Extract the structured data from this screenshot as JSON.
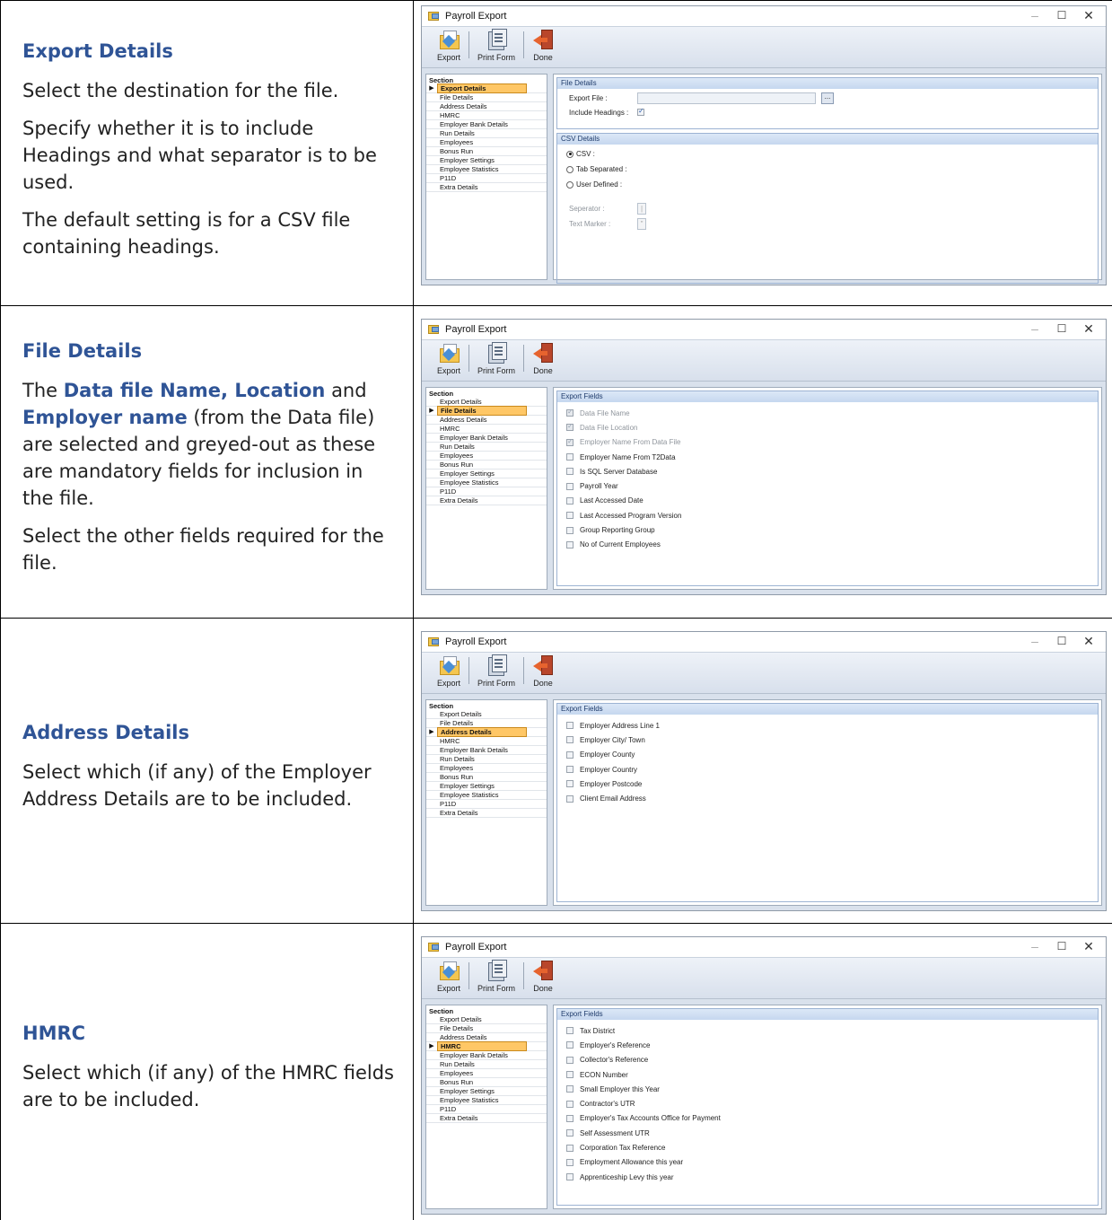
{
  "app": {
    "title": "Payroll Export",
    "toolbar": {
      "export_label": "Export",
      "print_label": "Print Form",
      "done_label": "Done"
    },
    "section_header": "Section",
    "sections": [
      "Export Details",
      "File Details",
      "Address Details",
      "HMRC",
      "Employer Bank Details",
      "Run Details",
      "Employees",
      "Bonus Run",
      "Employer Settings",
      "Employee Statistics",
      "P11D",
      "Extra Details"
    ],
    "export_fields_title": "Export Fields"
  },
  "rows": [
    {
      "heading": "Export Details",
      "p1": "Select the destination for the file.",
      "p2": "Specify whether it is to include Headings and what separator is to be used.",
      "p3": "The default setting is for a CSV file containing headings.",
      "file_details_title": "File Details",
      "export_file_label": "Export File :",
      "browse_label": "...",
      "include_headings_label": "Include Headings :",
      "csv_details_title": "CSV Details",
      "csv_label": "CSV :",
      "tab_label": "Tab Separated :",
      "user_label": "User Defined :",
      "separator_label": "Seperator :",
      "separator_value": "|",
      "text_marker_label": "Text Marker :",
      "text_marker_value": "\""
    },
    {
      "heading": "File Details",
      "intro": "The ",
      "hl1": "Data file Name, Location",
      "and": " and ",
      "hl2": "Employer name",
      "rest": " (from the Data file) are selected and greyed-out as these are mandatory fields for inclusion in the file.",
      "p2": "Select the other fields required for the file.",
      "fields": [
        {
          "label": "Data File Name",
          "checked": true,
          "disabled": true
        },
        {
          "label": "Data File Location",
          "checked": true,
          "disabled": true
        },
        {
          "label": "Employer Name From Data File",
          "checked": true,
          "disabled": true
        },
        {
          "label": "Employer Name From T2Data",
          "checked": false,
          "disabled": false
        },
        {
          "label": "Is SQL Server Database",
          "checked": false,
          "disabled": false
        },
        {
          "label": "Payroll Year",
          "checked": false,
          "disabled": false
        },
        {
          "label": "Last Accessed Date",
          "checked": false,
          "disabled": false
        },
        {
          "label": "Last Accessed Program Version",
          "checked": false,
          "disabled": false
        },
        {
          "label": "Group Reporting Group",
          "checked": false,
          "disabled": false
        },
        {
          "label": "No of Current Employees",
          "checked": false,
          "disabled": false
        }
      ]
    },
    {
      "heading": "Address Details",
      "p1": "Select which (if any) of the Employer Address Details are to be included.",
      "fields": [
        "Employer Address Line 1",
        "Employer City/ Town",
        "Employer County",
        "Employer Country",
        "Employer Postcode",
        "Client Email Address"
      ]
    },
    {
      "heading": "HMRC",
      "p1": "Select which (if any) of the HMRC fields are to be included.",
      "fields": [
        "Tax District",
        "Employer's Reference",
        "Collector's Reference",
        "ECON Number",
        "Small Employer this Year",
        "Contractor's UTR",
        "Employer's Tax Accounts Office for Payment",
        "Self Assessment UTR",
        "Corporation Tax Reference",
        "Employment Allowance this year",
        "Apprenticeship Levy this year"
      ]
    }
  ]
}
